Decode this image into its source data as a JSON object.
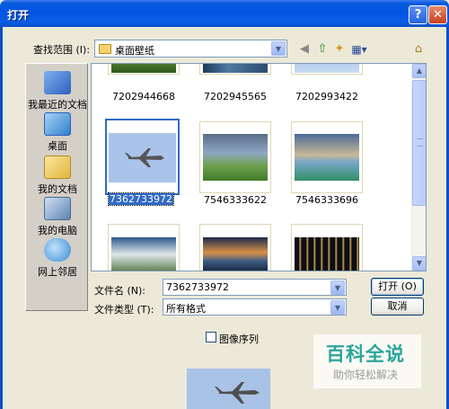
{
  "window": {
    "title": "打开"
  },
  "titlebar": {
    "help_glyph": "?",
    "close_glyph": "✕"
  },
  "lookin": {
    "label": "查找范围 (I):",
    "value": "桌面壁纸"
  },
  "toolbar": {
    "icons": [
      "back-icon",
      "up-folder-icon",
      "new-folder-icon",
      "views-menu-icon",
      "tools-icon"
    ],
    "back": "◀",
    "up": "⇧",
    "newfolder": "✦",
    "views": "▦▾",
    "extra": "⌂"
  },
  "places": [
    {
      "label": "我最近的文档",
      "icon": "recent-documents-icon",
      "color": "#3d6fc9"
    },
    {
      "label": "桌面",
      "icon": "desktop-icon",
      "color": "#3b8bd6"
    },
    {
      "label": "我的文档",
      "icon": "my-documents-icon",
      "color": "#e8c24c"
    },
    {
      "label": "我的电脑",
      "icon": "my-computer-icon",
      "color": "#6f8fb5"
    },
    {
      "label": "网上邻居",
      "icon": "network-places-icon",
      "color": "#4a9fd8"
    }
  ],
  "files": [
    {
      "name": "7202944668",
      "selected": false
    },
    {
      "name": "7202945565",
      "selected": false
    },
    {
      "name": "7202993422",
      "selected": false
    },
    {
      "name": "7362733972",
      "selected": true
    },
    {
      "name": "7546333622",
      "selected": false
    },
    {
      "name": "7546333696",
      "selected": false
    },
    {
      "name": "",
      "selected": false
    },
    {
      "name": "",
      "selected": false
    },
    {
      "name": "",
      "selected": false
    }
  ],
  "filename": {
    "label": "文件名 (N):",
    "value": "7362733972"
  },
  "filetype": {
    "label": "文件类型 (T):",
    "value": "所有格式"
  },
  "buttons": {
    "open": "打开 (O)",
    "cancel": "取消"
  },
  "image_sequence": {
    "label": "图像序列",
    "checked": false
  },
  "watermark": {
    "main": "百科全说",
    "sub": "助你轻松解决"
  },
  "colors": {
    "titlebar": "#0054e3",
    "dialog_bg": "#ece9d8",
    "selection": "#316ac5"
  }
}
